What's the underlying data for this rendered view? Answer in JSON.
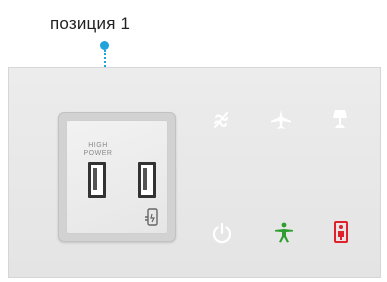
{
  "callout": {
    "label": "позиция 1"
  },
  "usb_module": {
    "label_line1": "HIGH",
    "label_line2": "POWER"
  },
  "icons": {
    "top_row": [
      "no-fan-icon",
      "airplane-icon",
      "reading-lamp-icon"
    ],
    "bottom_row": [
      "power-icon",
      "call-attendant-icon",
      "lavatory-occupied-icon"
    ]
  },
  "colors": {
    "leader": "#1fa3dd",
    "panel": "#e8e8e8",
    "glyph_white": "#ffffff",
    "attendant_green": "#2e9e2e",
    "lavatory_red": "#e0202a"
  }
}
